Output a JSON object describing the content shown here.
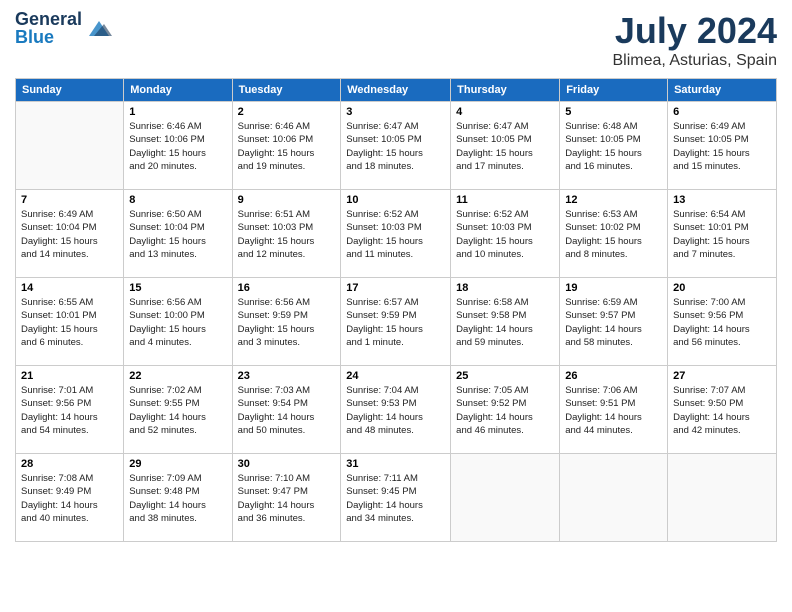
{
  "logo": {
    "general": "General",
    "blue": "Blue"
  },
  "title": "July 2024",
  "location": "Blimea, Asturias, Spain",
  "days_of_week": [
    "Sunday",
    "Monday",
    "Tuesday",
    "Wednesday",
    "Thursday",
    "Friday",
    "Saturday"
  ],
  "weeks": [
    [
      {
        "day": "",
        "info": ""
      },
      {
        "day": "1",
        "info": "Sunrise: 6:46 AM\nSunset: 10:06 PM\nDaylight: 15 hours\nand 20 minutes."
      },
      {
        "day": "2",
        "info": "Sunrise: 6:46 AM\nSunset: 10:06 PM\nDaylight: 15 hours\nand 19 minutes."
      },
      {
        "day": "3",
        "info": "Sunrise: 6:47 AM\nSunset: 10:05 PM\nDaylight: 15 hours\nand 18 minutes."
      },
      {
        "day": "4",
        "info": "Sunrise: 6:47 AM\nSunset: 10:05 PM\nDaylight: 15 hours\nand 17 minutes."
      },
      {
        "day": "5",
        "info": "Sunrise: 6:48 AM\nSunset: 10:05 PM\nDaylight: 15 hours\nand 16 minutes."
      },
      {
        "day": "6",
        "info": "Sunrise: 6:49 AM\nSunset: 10:05 PM\nDaylight: 15 hours\nand 15 minutes."
      }
    ],
    [
      {
        "day": "7",
        "info": "Sunrise: 6:49 AM\nSunset: 10:04 PM\nDaylight: 15 hours\nand 14 minutes."
      },
      {
        "day": "8",
        "info": "Sunrise: 6:50 AM\nSunset: 10:04 PM\nDaylight: 15 hours\nand 13 minutes."
      },
      {
        "day": "9",
        "info": "Sunrise: 6:51 AM\nSunset: 10:03 PM\nDaylight: 15 hours\nand 12 minutes."
      },
      {
        "day": "10",
        "info": "Sunrise: 6:52 AM\nSunset: 10:03 PM\nDaylight: 15 hours\nand 11 minutes."
      },
      {
        "day": "11",
        "info": "Sunrise: 6:52 AM\nSunset: 10:03 PM\nDaylight: 15 hours\nand 10 minutes."
      },
      {
        "day": "12",
        "info": "Sunrise: 6:53 AM\nSunset: 10:02 PM\nDaylight: 15 hours\nand 8 minutes."
      },
      {
        "day": "13",
        "info": "Sunrise: 6:54 AM\nSunset: 10:01 PM\nDaylight: 15 hours\nand 7 minutes."
      }
    ],
    [
      {
        "day": "14",
        "info": "Sunrise: 6:55 AM\nSunset: 10:01 PM\nDaylight: 15 hours\nand 6 minutes."
      },
      {
        "day": "15",
        "info": "Sunrise: 6:56 AM\nSunset: 10:00 PM\nDaylight: 15 hours\nand 4 minutes."
      },
      {
        "day": "16",
        "info": "Sunrise: 6:56 AM\nSunset: 9:59 PM\nDaylight: 15 hours\nand 3 minutes."
      },
      {
        "day": "17",
        "info": "Sunrise: 6:57 AM\nSunset: 9:59 PM\nDaylight: 15 hours\nand 1 minute."
      },
      {
        "day": "18",
        "info": "Sunrise: 6:58 AM\nSunset: 9:58 PM\nDaylight: 14 hours\nand 59 minutes."
      },
      {
        "day": "19",
        "info": "Sunrise: 6:59 AM\nSunset: 9:57 PM\nDaylight: 14 hours\nand 58 minutes."
      },
      {
        "day": "20",
        "info": "Sunrise: 7:00 AM\nSunset: 9:56 PM\nDaylight: 14 hours\nand 56 minutes."
      }
    ],
    [
      {
        "day": "21",
        "info": "Sunrise: 7:01 AM\nSunset: 9:56 PM\nDaylight: 14 hours\nand 54 minutes."
      },
      {
        "day": "22",
        "info": "Sunrise: 7:02 AM\nSunset: 9:55 PM\nDaylight: 14 hours\nand 52 minutes."
      },
      {
        "day": "23",
        "info": "Sunrise: 7:03 AM\nSunset: 9:54 PM\nDaylight: 14 hours\nand 50 minutes."
      },
      {
        "day": "24",
        "info": "Sunrise: 7:04 AM\nSunset: 9:53 PM\nDaylight: 14 hours\nand 48 minutes."
      },
      {
        "day": "25",
        "info": "Sunrise: 7:05 AM\nSunset: 9:52 PM\nDaylight: 14 hours\nand 46 minutes."
      },
      {
        "day": "26",
        "info": "Sunrise: 7:06 AM\nSunset: 9:51 PM\nDaylight: 14 hours\nand 44 minutes."
      },
      {
        "day": "27",
        "info": "Sunrise: 7:07 AM\nSunset: 9:50 PM\nDaylight: 14 hours\nand 42 minutes."
      }
    ],
    [
      {
        "day": "28",
        "info": "Sunrise: 7:08 AM\nSunset: 9:49 PM\nDaylight: 14 hours\nand 40 minutes."
      },
      {
        "day": "29",
        "info": "Sunrise: 7:09 AM\nSunset: 9:48 PM\nDaylight: 14 hours\nand 38 minutes."
      },
      {
        "day": "30",
        "info": "Sunrise: 7:10 AM\nSunset: 9:47 PM\nDaylight: 14 hours\nand 36 minutes."
      },
      {
        "day": "31",
        "info": "Sunrise: 7:11 AM\nSunset: 9:45 PM\nDaylight: 14 hours\nand 34 minutes."
      },
      {
        "day": "",
        "info": ""
      },
      {
        "day": "",
        "info": ""
      },
      {
        "day": "",
        "info": ""
      }
    ]
  ]
}
